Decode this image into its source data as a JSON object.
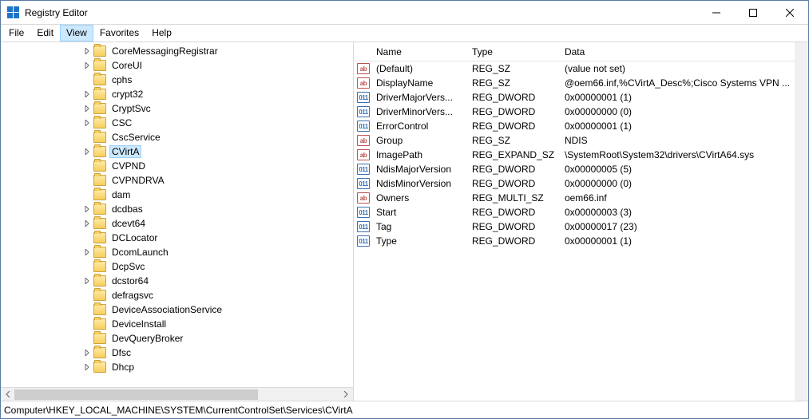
{
  "window": {
    "title": "Registry Editor"
  },
  "menu": {
    "file": "File",
    "edit": "Edit",
    "view": "View",
    "favorites": "Favorites",
    "help": "Help"
  },
  "tree": {
    "indent_base": 100,
    "items": [
      {
        "label": "CoreMessagingRegistrar",
        "expand": "closed",
        "indent": 0
      },
      {
        "label": "CoreUI",
        "expand": "closed",
        "indent": 0
      },
      {
        "label": "cphs",
        "expand": "none",
        "indent": 0
      },
      {
        "label": "crypt32",
        "expand": "closed",
        "indent": 0
      },
      {
        "label": "CryptSvc",
        "expand": "closed",
        "indent": 0
      },
      {
        "label": "CSC",
        "expand": "closed",
        "indent": 0
      },
      {
        "label": "CscService",
        "expand": "none",
        "indent": 0
      },
      {
        "label": "CVirtA",
        "expand": "closed",
        "indent": 0,
        "selected": true
      },
      {
        "label": "CVPND",
        "expand": "none",
        "indent": 0
      },
      {
        "label": "CVPNDRVA",
        "expand": "none",
        "indent": 0
      },
      {
        "label": "dam",
        "expand": "none",
        "indent": 0
      },
      {
        "label": "dcdbas",
        "expand": "closed",
        "indent": 0
      },
      {
        "label": "dcevt64",
        "expand": "closed",
        "indent": 0
      },
      {
        "label": "DCLocator",
        "expand": "none",
        "indent": 0
      },
      {
        "label": "DcomLaunch",
        "expand": "closed",
        "indent": 0
      },
      {
        "label": "DcpSvc",
        "expand": "none",
        "indent": 0
      },
      {
        "label": "dcstor64",
        "expand": "closed",
        "indent": 0
      },
      {
        "label": "defragsvc",
        "expand": "none",
        "indent": 0
      },
      {
        "label": "DeviceAssociationService",
        "expand": "none",
        "indent": 0
      },
      {
        "label": "DeviceInstall",
        "expand": "none",
        "indent": 0
      },
      {
        "label": "DevQueryBroker",
        "expand": "none",
        "indent": 0
      },
      {
        "label": "Dfsc",
        "expand": "closed",
        "indent": 0
      },
      {
        "label": "Dhcp",
        "expand": "closed",
        "indent": 0
      }
    ]
  },
  "list": {
    "columns": {
      "name": "Name",
      "type": "Type",
      "data": "Data"
    },
    "rows": [
      {
        "icon": "sz",
        "name": "(Default)",
        "type": "REG_SZ",
        "data": "(value not set)"
      },
      {
        "icon": "sz",
        "name": "DisplayName",
        "type": "REG_SZ",
        "data": "@oem66.inf,%CVirtA_Desc%;Cisco Systems VPN ..."
      },
      {
        "icon": "bin",
        "name": "DriverMajorVers...",
        "type": "REG_DWORD",
        "data": "0x00000001 (1)"
      },
      {
        "icon": "bin",
        "name": "DriverMinorVers...",
        "type": "REG_DWORD",
        "data": "0x00000000 (0)"
      },
      {
        "icon": "bin",
        "name": "ErrorControl",
        "type": "REG_DWORD",
        "data": "0x00000001 (1)"
      },
      {
        "icon": "sz",
        "name": "Group",
        "type": "REG_SZ",
        "data": "NDIS"
      },
      {
        "icon": "sz",
        "name": "ImagePath",
        "type": "REG_EXPAND_SZ",
        "data": "\\SystemRoot\\System32\\drivers\\CVirtA64.sys"
      },
      {
        "icon": "bin",
        "name": "NdisMajorVersion",
        "type": "REG_DWORD",
        "data": "0x00000005 (5)"
      },
      {
        "icon": "bin",
        "name": "NdisMinorVersion",
        "type": "REG_DWORD",
        "data": "0x00000000 (0)"
      },
      {
        "icon": "sz",
        "name": "Owners",
        "type": "REG_MULTI_SZ",
        "data": "oem66.inf"
      },
      {
        "icon": "bin",
        "name": "Start",
        "type": "REG_DWORD",
        "data": "0x00000003 (3)"
      },
      {
        "icon": "bin",
        "name": "Tag",
        "type": "REG_DWORD",
        "data": "0x00000017 (23)"
      },
      {
        "icon": "bin",
        "name": "Type",
        "type": "REG_DWORD",
        "data": "0x00000001 (1)"
      }
    ]
  },
  "statusbar": {
    "path": "Computer\\HKEY_LOCAL_MACHINE\\SYSTEM\\CurrentControlSet\\Services\\CVirtA"
  },
  "icons": {
    "sz_text": "ab",
    "bin_text": "011"
  }
}
